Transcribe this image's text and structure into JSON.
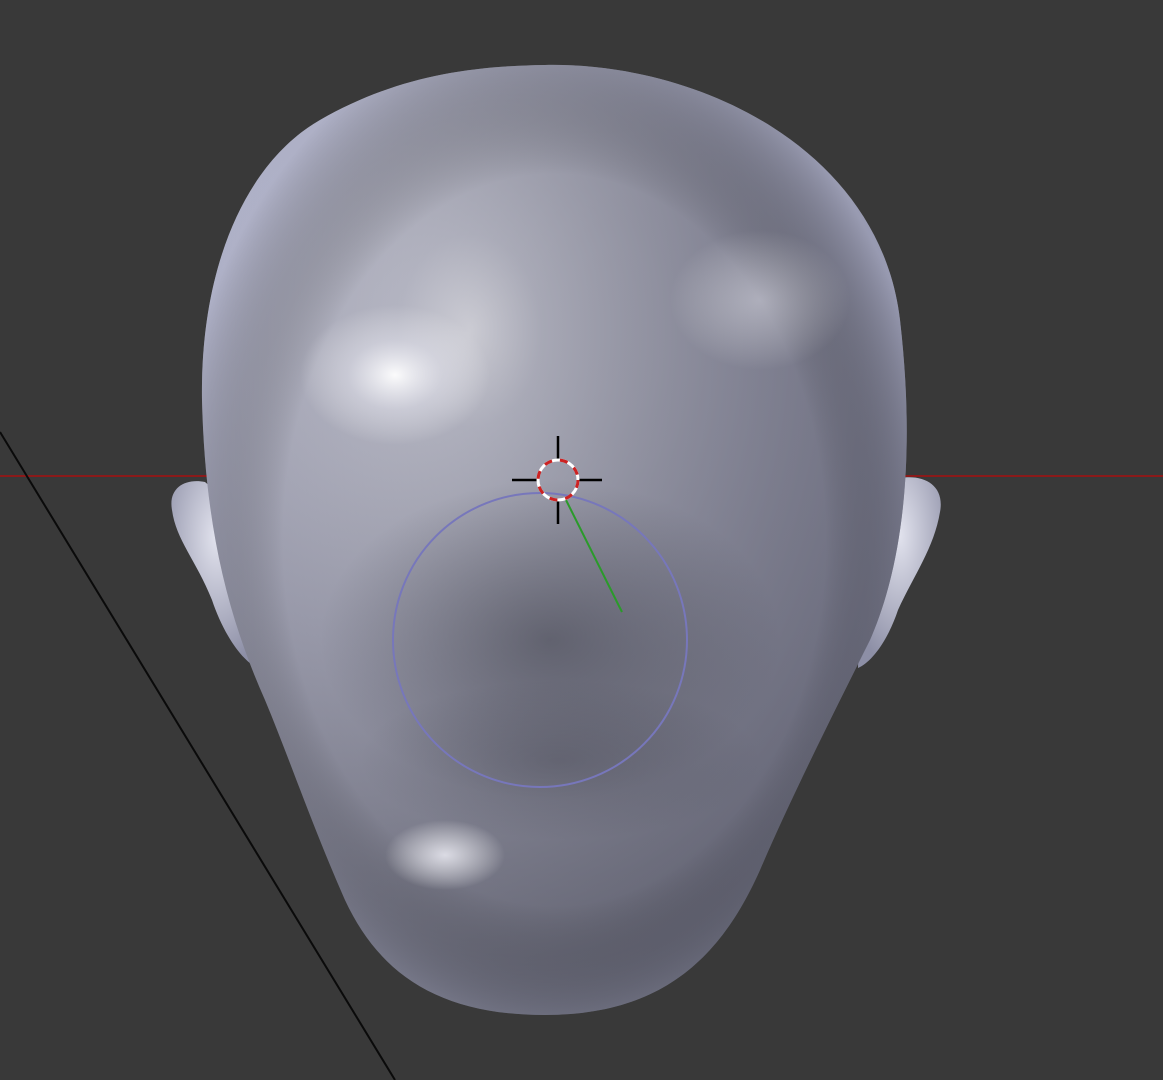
{
  "viewport": {
    "background": "#393939",
    "object": "sculpt-head-mesh",
    "tool": "sculpt-brush",
    "cursor": "3d-cursor",
    "axes": {
      "x_axis_color": "#8b1a1a",
      "frame_line_color": "#000000"
    },
    "brush": {
      "ring_color": "#7777bb",
      "normal_color": "#2a9a2a"
    },
    "colors": {
      "mesh_light": "#d8d9e6",
      "mesh_mid": "#a3a4b8",
      "mesh_dark": "#5f6070",
      "cursor_red": "#cc2222",
      "cursor_white": "#ffffff",
      "crosshair": "#000000"
    }
  }
}
